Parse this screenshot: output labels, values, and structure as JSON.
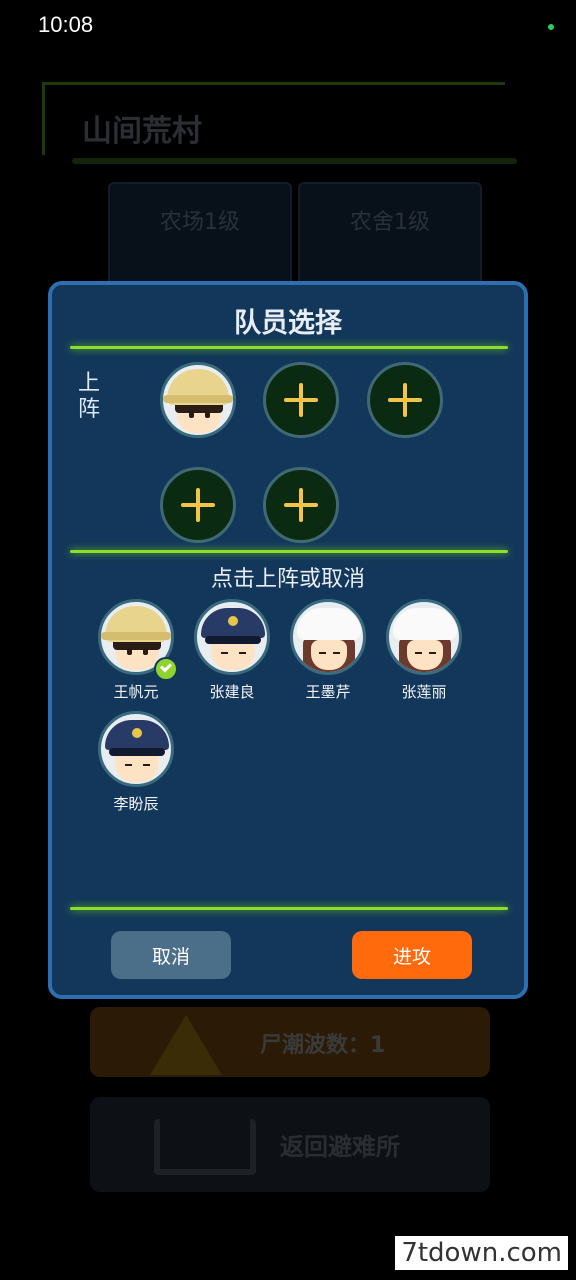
{
  "status_bar": {
    "time": "10:08"
  },
  "background": {
    "title": "山间荒村",
    "cards": [
      "农场1级",
      "农舍1级"
    ],
    "warning_text": "尸潮波数：1",
    "return_label": "返回避难所"
  },
  "dialog": {
    "title": "队员选择",
    "lineup_label": "上阵",
    "hint": "点击上阵或取消",
    "members": [
      {
        "name": "王帆元",
        "type": "straw-hat",
        "selected": true
      },
      {
        "name": "张建良",
        "type": "police",
        "selected": false
      },
      {
        "name": "王墨芹",
        "type": "girl",
        "selected": false
      },
      {
        "name": "张莲丽",
        "type": "girl",
        "selected": false
      },
      {
        "name": "李盼辰",
        "type": "police",
        "selected": false
      }
    ],
    "cancel_label": "取消",
    "attack_label": "进攻"
  },
  "watermark": "7tdown.com",
  "colors": {
    "accent_green": "#8be12a",
    "attack_orange": "#ff6a0d",
    "dialog_bg": "#12375a"
  }
}
